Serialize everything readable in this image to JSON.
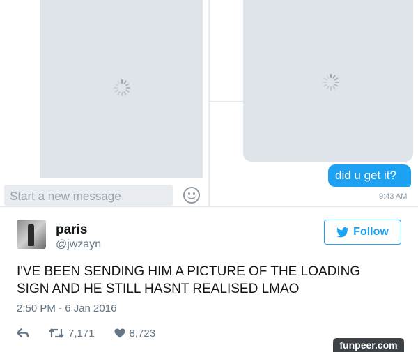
{
  "dm_left": {
    "compose_placeholder": "Start a new message",
    "emoji_icon": "smiley-icon"
  },
  "dm_right": {
    "message_text": "did u get it?",
    "message_time": "9:43 AM",
    "bubble_color": "#1da1f2"
  },
  "tweet": {
    "name": "paris",
    "handle": "@jwzayn",
    "follow_label": "Follow",
    "text": "I'VE BEEN SENDING HIM A PICTURE OF THE LOADING SIGN AND HE STILL HASNT REALISED LMAO",
    "timestamp": "2:50 PM - 6 Jan 2016",
    "actions": {
      "reply_icon": "reply-icon",
      "retweet_icon": "retweet-icon",
      "retweet_count": "7,171",
      "like_icon": "heart-icon",
      "like_count": "8,723"
    },
    "accent_color": "#1da1f2"
  },
  "watermark": "funpeer.com"
}
